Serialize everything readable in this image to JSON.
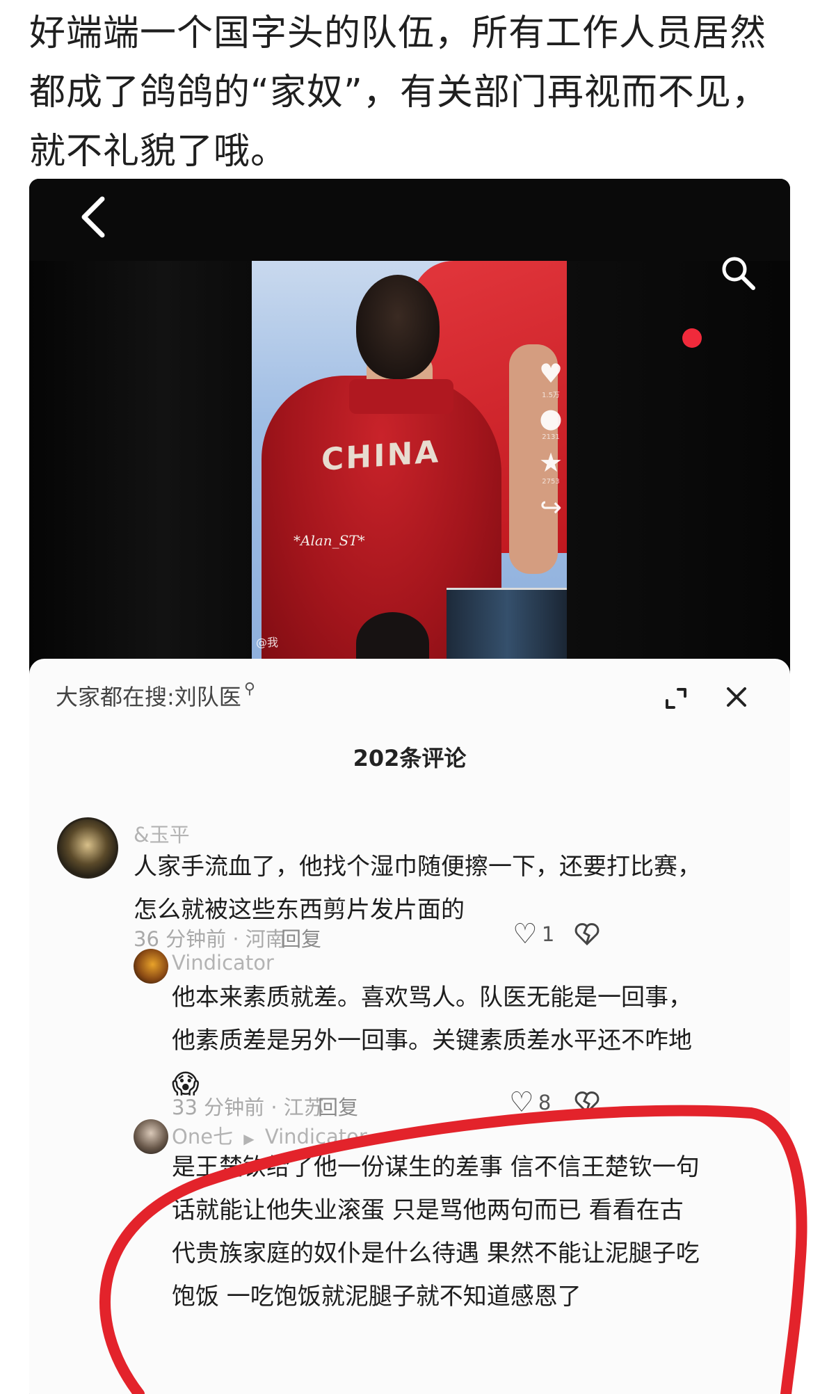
{
  "post": {
    "line1": "好端端一个国字头的队伍，所有工作人员居然",
    "line2": "都成了鸽鸽的“家奴”，有关部门再视而不见，",
    "line3": "就不礼貌了哦。"
  },
  "video": {
    "jersey_text": "CHINA",
    "jersey_name": "*Alan_ST*",
    "watermark": "@我",
    "side_actions": [
      {
        "icon": "heart-icon",
        "glyph": "♥",
        "count": "1.5万"
      },
      {
        "icon": "comment-icon",
        "glyph": "●",
        "count": "2131"
      },
      {
        "icon": "star-icon",
        "glyph": "★",
        "count": "2753"
      },
      {
        "icon": "share-icon",
        "glyph": "↪",
        "count": ""
      }
    ],
    "live_dot_color": "#f02a3b"
  },
  "panel": {
    "search_prefix": "大家都在搜:",
    "search_term": "刘队医",
    "comment_count": "202条评论"
  },
  "comments": [
    {
      "user": "&玉平",
      "text_line1": "人家手流血了，他找个湿巾随便擦一下，还要打比赛，",
      "text_line2": "怎么就被这些东西剪片发片面的",
      "meta": "36 分钟前 · 河南",
      "reply": "回复",
      "likes": "1"
    },
    {
      "user": "Vindicator",
      "text_line1": "他本来素质就差。喜欢骂人。队医无能是一回事，",
      "text_line2": "他素质差是另外一回事。关键素质差水平还不咋地",
      "emoji": "😱",
      "meta": "33 分钟前 · 江苏",
      "reply": "回复",
      "likes": "8"
    },
    {
      "user": "One七",
      "reply_to": "Vindicator",
      "text_line1": "是王楚钦给了他一份谋生的差事  信不信王楚钦一句",
      "text_line2": "话就能让他失业滚蛋  只是骂他两句而已  看看在古",
      "text_line3": "代贵族家庭的奴仆是什么待遇  果然不能让泥腿子吃",
      "text_line4": "饱饭  一吃饱饭就泥腿子就不知道感恩了"
    }
  ],
  "annotation_color": "#e3232b"
}
